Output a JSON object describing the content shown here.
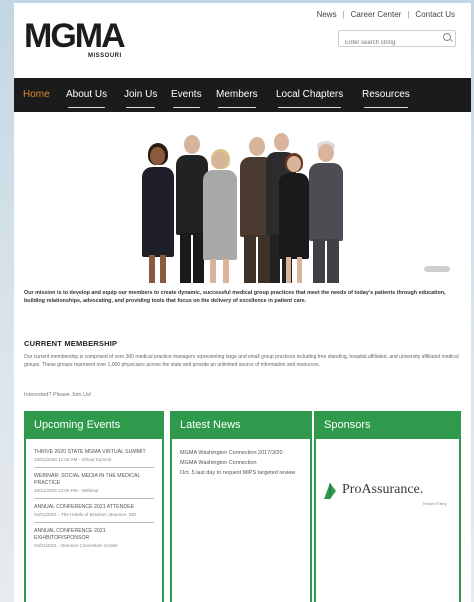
{
  "header": {
    "logo_text": "MGMA",
    "logo_sub": "MISSOURI",
    "top_links": [
      "News",
      "Career Center",
      "Contact Us"
    ],
    "search_placeholder": "Enter search string"
  },
  "nav": {
    "items": [
      "Home",
      "About Us",
      "Join Us",
      "Events",
      "Members",
      "Local Chapters",
      "Resources"
    ],
    "active": "Home"
  },
  "mission": "Our mission is to develop and equip our members to create dynamic, successful medical group practices that meet the needs of today's patients through education, building relationships, advocating, and providing tools that focus on the delivery of excellence in patient care.",
  "current_membership": {
    "title": "CURRENT MEMBERSHIP",
    "text": "Our current membership is comprised of over 300 medical practice managers representing large and small group practices including free standing, hospital affiliated, and university affiliated medical groups. These groups represent over 1,000 physicians across the state and provide an unlimited source of information and resources.",
    "interested": "Interested? Please Join Us!"
  },
  "columns": {
    "events": {
      "title": "Upcoming Events",
      "items": [
        {
          "title": "THRIVE 2020 STATE MGMA VIRTUAL SUMMIT",
          "detail": "10/01/2020 11:00 AM - Virtual Summit"
        },
        {
          "title": "WEBINAR: SOCIAL MEDIA IN THE MEDICAL PRACTICE",
          "detail": "10/11/2020 12:00 PM - Webinar"
        },
        {
          "title": "ANNUAL CONFERENCE 2021 ATTENDEE",
          "detail": "04/01/2021 - The Hotels of Branson, Branson, MO"
        },
        {
          "title": "ANNUAL CONFERENCE 2021 EXHIBITOR/SPONSOR",
          "detail": "04/01/2021 - Branson Convention Center"
        }
      ]
    },
    "news": {
      "title": "Latest News",
      "items": [
        "MGMA Washington Connection 2017/3/20",
        "MGMA Washington Connection",
        "Oct. 5 last day to request MIPS targeted review"
      ]
    },
    "sponsors": {
      "title": "Sponsors",
      "sponsor_name": "ProAssurance.",
      "sponsor_tagline": "Treated Fairly"
    }
  },
  "colors": {
    "nav_bg": "#1b1b1b",
    "nav_active": "#e08a2c",
    "accent_green": "#2f9a4c"
  }
}
